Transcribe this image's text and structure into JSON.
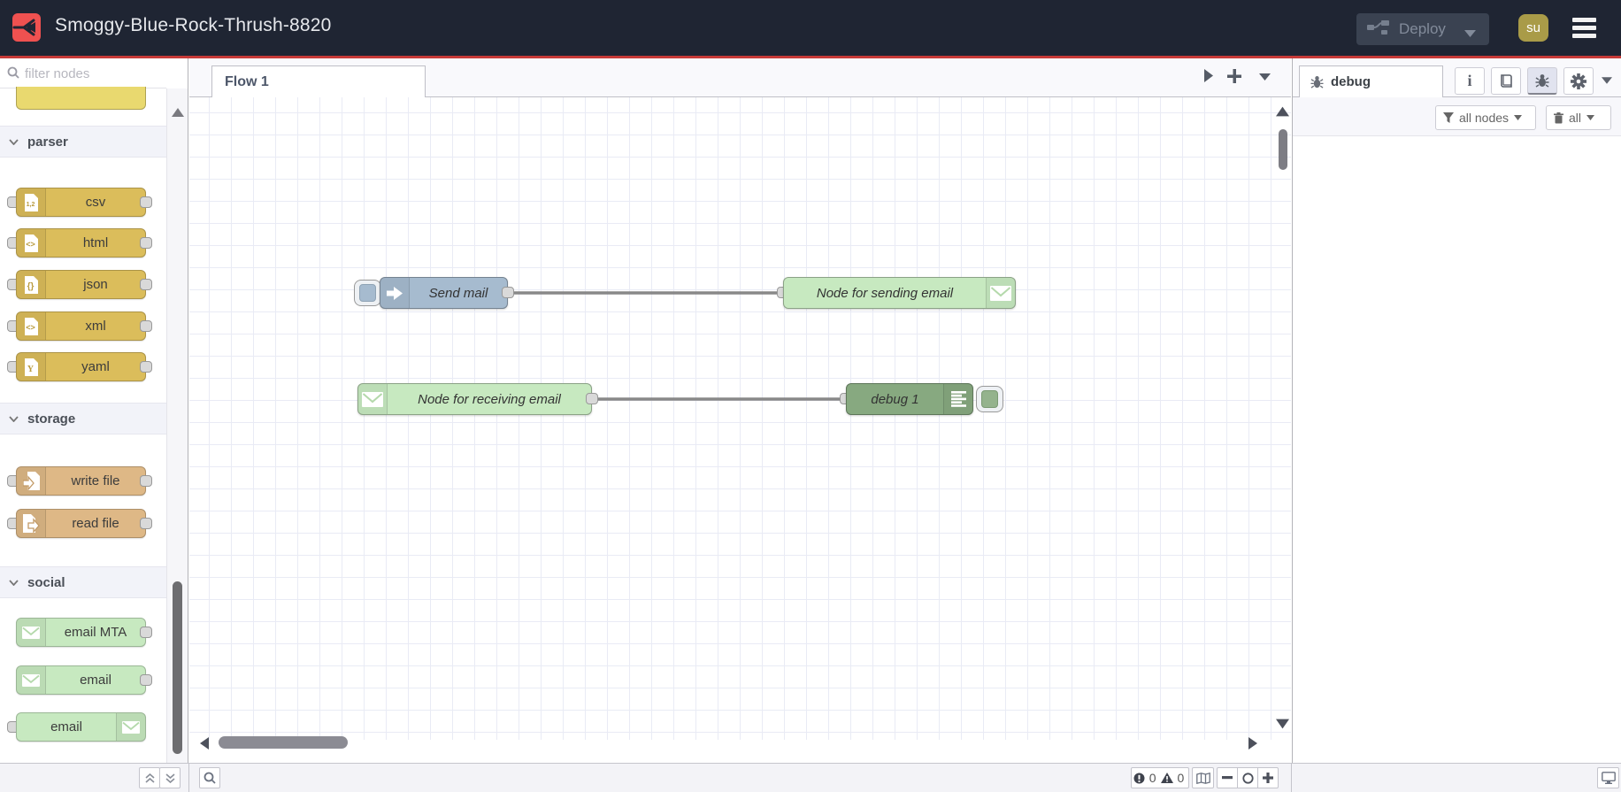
{
  "header": {
    "title": "Smoggy-Blue-Rock-Thrush-8820",
    "deploy_label": "Deploy",
    "avatar_initials": "su"
  },
  "colors": {
    "header_bg": "#1f2533",
    "accent_red": "#c73a38",
    "logo_red": "#ef5150",
    "inject_node": "#a6bbcf",
    "email_node": "#c7e9c0",
    "debug_node": "#87a980",
    "parser_node": "#dbbd5b",
    "storage_node": "#deb886",
    "avatar_gold": "#a99b48"
  },
  "palette": {
    "filter_placeholder": "filter nodes",
    "sections": [
      {
        "label": "parser",
        "items": [
          {
            "label": "csv"
          },
          {
            "label": "html"
          },
          {
            "label": "json"
          },
          {
            "label": "xml"
          },
          {
            "label": "yaml"
          }
        ]
      },
      {
        "label": "storage",
        "items": [
          {
            "label": "write file"
          },
          {
            "label": "read file"
          }
        ]
      },
      {
        "label": "social",
        "items": [
          {
            "label": "email MTA"
          },
          {
            "label": "email"
          },
          {
            "label": "email"
          }
        ]
      }
    ]
  },
  "workspace": {
    "tab_label": "Flow 1",
    "nodes": [
      {
        "label": "Send mail"
      },
      {
        "label": "Node for sending email"
      },
      {
        "label": "Node for receiving email"
      },
      {
        "label": "debug 1"
      }
    ]
  },
  "sidebar": {
    "tab_label": "debug",
    "filter_label": "all nodes",
    "clear_label": "all"
  },
  "statusbar": {
    "error_count": "0",
    "warning_count": "0"
  },
  "icons": {
    "logo": "node-red-logo",
    "deploy": "deploy-wire-icon",
    "menu": "hamburger-icon",
    "search": "magnifier-icon",
    "bug": "bug-icon",
    "info": "info-icon",
    "book": "book-icon",
    "gear": "gear-icon",
    "funnel": "funnel-icon",
    "trash": "trash-icon",
    "map": "map-icon",
    "monitor": "monitor-icon",
    "envelope": "envelope-icon",
    "inject": "inject-arrow-icon",
    "debug_lines": "debug-list-icon"
  }
}
